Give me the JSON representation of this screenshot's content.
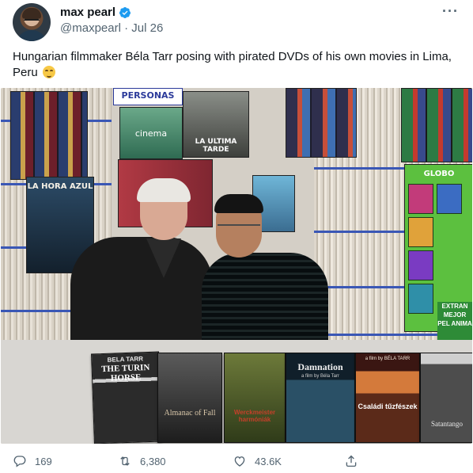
{
  "tweet": {
    "author": {
      "display_name": "max pearl",
      "handle": "@maxpearl",
      "date": "Jul 26",
      "verified_icon": "verified-badge-icon",
      "avatar_icon": "avatar"
    },
    "more_label": "···",
    "text": "Hungarian filmmaker Béla Tarr posing with pirated DVDs of his own movies in Lima, Peru",
    "emoji": "smiling-face-icon"
  },
  "photo": {
    "posters": {
      "personas": "PERSONAS",
      "cinema": "cinema",
      "ultima_tarde": "LA ULTIMA TARDE",
      "la_hora_azul": "LA HORA AZUL",
      "globo": "GLOBO",
      "mejor": "EXTRAN MEJOR PEL ANIMA"
    },
    "dvds": [
      {
        "top": "BELA TARR",
        "title": "THE TURIN HORSE"
      },
      {
        "title": "Almanac of Fall"
      },
      {
        "title": "Werckmeister harmóniák"
      },
      {
        "title": "Damnation",
        "sub": "a film by Béla Tarr"
      },
      {
        "top": "a film by BÉLA TARR",
        "title": "Családi tűzfészek"
      },
      {
        "title": "Satantango"
      }
    ]
  },
  "actions": {
    "reply_count": "169",
    "retweet_count": "6,380",
    "like_count": "43.6K",
    "icons": {
      "reply": "reply-icon",
      "retweet": "retweet-icon",
      "like": "heart-icon",
      "share": "share-icon"
    }
  }
}
